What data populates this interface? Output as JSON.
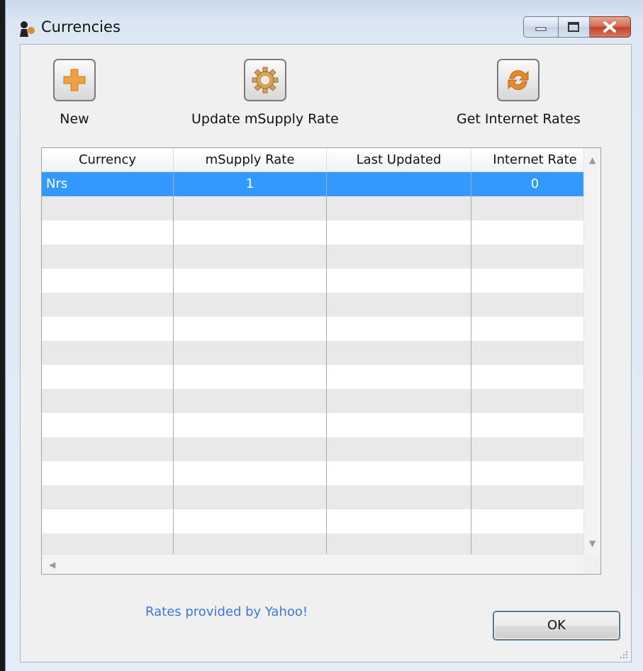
{
  "window": {
    "title": "Currencies",
    "icons": {
      "app": "mSupply-app-icon",
      "minimize": "minimize-icon",
      "maximize": "maximize-icon",
      "close": "close-icon"
    }
  },
  "toolbar": {
    "new_label": "New",
    "new_icon": "plus-icon",
    "update_label": "Update mSupply Rate",
    "update_icon": "gear-icon",
    "internet_label": "Get Internet Rates",
    "internet_icon": "refresh-icon"
  },
  "table": {
    "columns": [
      "Currency",
      "mSupply Rate",
      "Last Updated",
      "Internet Rate"
    ],
    "rows": [
      {
        "currency": "Nrs",
        "msupply_rate": "1",
        "last_updated": "",
        "internet_rate": "0",
        "selected": true
      }
    ],
    "selection_color": "#3399ff"
  },
  "footer": {
    "link_text": "Rates provided by Yahoo!",
    "ok_label": "OK"
  },
  "colors": {
    "accent": "#3399ff",
    "link": "#3b78d8",
    "close_button": "#c0432c"
  }
}
